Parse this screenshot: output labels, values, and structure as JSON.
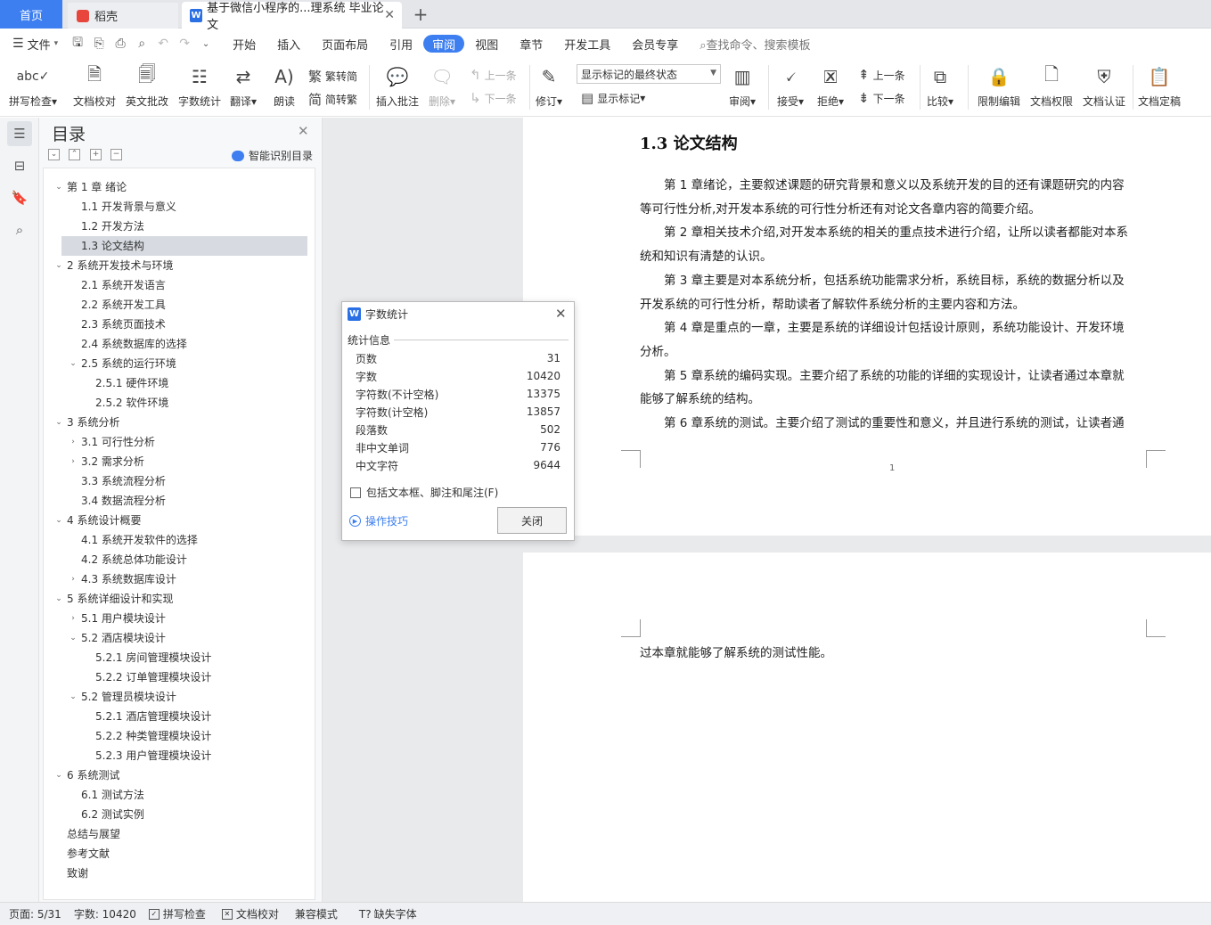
{
  "tabs": {
    "home": "首页",
    "daoke": "稻壳",
    "doc": "基于微信小程序的...理系统 毕业论文",
    "close_glyph": "✕",
    "add_glyph": "+"
  },
  "menu": {
    "file": "文件",
    "items": [
      "开始",
      "插入",
      "页面布局",
      "引用",
      "审阅",
      "视图",
      "章节",
      "开发工具",
      "会员专享"
    ],
    "active": "审阅",
    "search": "查找命令、搜索模板"
  },
  "ribbon": {
    "spell_check": "拼写检查",
    "doc_proof": "文档校对",
    "eng_correct": "英文批改",
    "word_count": "字数统计",
    "translate": "翻译",
    "read_aloud": "朗读",
    "trad_simp": "繁转简",
    "simp_trad": "简转繁",
    "insert_comment": "插入批注",
    "delete": "删除",
    "prev_comment": "上一条",
    "next_comment": "下一条",
    "revise": "修订",
    "markup_state": "显示标记的最终状态",
    "show_markup": "显示标记",
    "review": "审阅",
    "accept": "接受",
    "reject": "拒绝",
    "prev_change": "上一条",
    "next_change": "下一条",
    "compare": "比较",
    "restrict_edit": "限制编辑",
    "doc_rights": "文档权限",
    "doc_cert": "文档认证",
    "doc_final": "文档定稿"
  },
  "toc": {
    "title": "目录",
    "smart": "智能识别目录",
    "items": [
      {
        "text": "第 1 章  绪论",
        "caret": "⌄"
      },
      {
        "text": "1.1 开发背景与意义",
        "caret": ""
      },
      {
        "text": "1.2 开发方法",
        "caret": ""
      },
      {
        "text": "1.3 论文结构",
        "caret": ""
      },
      {
        "text": "2 系统开发技术与环境",
        "caret": "⌄"
      },
      {
        "text": "2.1  系统开发语言",
        "caret": ""
      },
      {
        "text": "2.2  系统开发工具",
        "caret": ""
      },
      {
        "text": "2.3  系统页面技术",
        "caret": ""
      },
      {
        "text": "2.4  系统数据库的选择",
        "caret": ""
      },
      {
        "text": "2.5  系统的运行环境",
        "caret": "⌄"
      },
      {
        "text": "2.5.1  硬件环境",
        "caret": ""
      },
      {
        "text": "2.5.2  软件环境",
        "caret": ""
      },
      {
        "text": "3 系统分析",
        "caret": "⌄"
      },
      {
        "text": "3.1 可行性分析",
        "caret": "›"
      },
      {
        "text": "3.2 需求分析",
        "caret": "›"
      },
      {
        "text": "3.3 系统流程分析",
        "caret": ""
      },
      {
        "text": "3.4 数据流程分析",
        "caret": ""
      },
      {
        "text": "4 系统设计概要",
        "caret": "⌄"
      },
      {
        "text": "4.1  系统开发软件的选择",
        "caret": ""
      },
      {
        "text": "4.2  系统总体功能设计",
        "caret": ""
      },
      {
        "text": "4.3  系统数据库设计",
        "caret": "›"
      },
      {
        "text": "5 系统详细设计和实现",
        "caret": "⌄"
      },
      {
        "text": "5.1  用户模块设计",
        "caret": "›"
      },
      {
        "text": "5.2  酒店模块设计",
        "caret": "⌄"
      },
      {
        "text": "5.2.1  房间管理模块设计",
        "caret": ""
      },
      {
        "text": "5.2.2  订单管理模块设计",
        "caret": ""
      },
      {
        "text": "5.2  管理员模块设计",
        "caret": "⌄"
      },
      {
        "text": "5.2.1  酒店管理模块设计",
        "caret": ""
      },
      {
        "text": "5.2.2  种类管理模块设计",
        "caret": ""
      },
      {
        "text": "5.2.3  用户管理模块设计",
        "caret": ""
      },
      {
        "text": "6 系统测试",
        "caret": "⌄"
      },
      {
        "text": "6.1  测试方法",
        "caret": ""
      },
      {
        "text": "6.2  测试实例",
        "caret": ""
      },
      {
        "text": "总结与展望",
        "caret": ""
      },
      {
        "text": "参考文献",
        "caret": ""
      },
      {
        "text": "致谢",
        "caret": ""
      }
    ]
  },
  "document": {
    "heading": "1.3 论文结构",
    "lines": [
      "　　第 1 章绪论，主要叙述课题的研究背景和意义以及系统开发的目的还有课题研究的内容",
      "等可行性分析,对开发本系统的可行性分析还有对论文各章内容的简要介绍。",
      "　　第 2 章相关技术介绍,对开发本系统的相关的重点技术进行介绍，让所以读者都能对本系",
      "统和知识有清楚的认识。",
      "　　第 3 章主要是对本系统分析，包括系统功能需求分析，系统目标，系统的数据分析以及",
      "开发系统的可行性分析，帮助读者了解软件系统分析的主要内容和方法。",
      "　　第 4 章是重点的一章，主要是系统的详细设计包括设计原则，系统功能设计、开发环境",
      "分析。",
      "　　第 5 章系统的编码实现。主要介绍了系统的功能的详细的实现设计，让读者通过本章就",
      "能够了解系统的结构。",
      "　　第 6 章系统的测试。主要介绍了测试的重要性和意义，并且进行系统的测试，让读者通"
    ],
    "page_number": "1",
    "page2_text": "过本章就能够了解系统的测试性能。"
  },
  "dialog": {
    "title": "字数统计",
    "group": "统计信息",
    "rows": [
      {
        "label": "页数",
        "value": "31"
      },
      {
        "label": "字数",
        "value": "10420"
      },
      {
        "label": "字符数(不计空格)",
        "value": "13375"
      },
      {
        "label": "字符数(计空格)",
        "value": "13857"
      },
      {
        "label": "段落数",
        "value": "502"
      },
      {
        "label": "非中文单词",
        "value": "776"
      },
      {
        "label": "中文字符",
        "value": "9644"
      }
    ],
    "checkbox": "包括文本框、脚注和尾注(F)",
    "tips": "操作技巧",
    "close": "关闭"
  },
  "status": {
    "page": "页面: 5/31",
    "words": "字数: 10420",
    "spell": "拼写检查",
    "proof": "文档校对",
    "compat": "兼容模式",
    "missing_font": "缺失字体"
  },
  "colors": {
    "accent": "#3d7ff0",
    "tab_home_bg": "#3d7ff0",
    "toc_selected": "#d7dbe1"
  }
}
